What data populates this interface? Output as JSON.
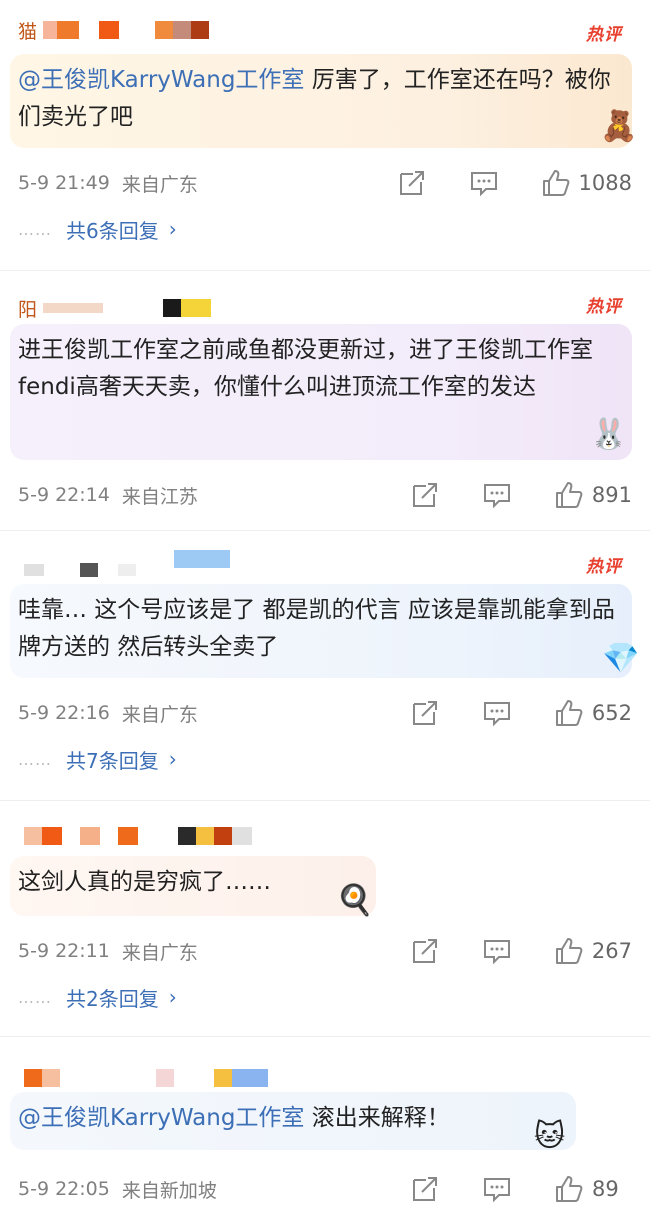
{
  "hot_badge": "热评",
  "comments": [
    {
      "name": "猫",
      "mention": "@王俊凯KarryWang工作室",
      "text": " 厉害了，工作室还在吗？被你们卖光了吧",
      "time": "5-9 21:49",
      "location": "来自广东",
      "likes": "1088",
      "replies": "共6条回复",
      "mosaic": [
        "#f6b49a",
        "#f07a2c",
        "#ffffff",
        "#f05a14",
        "#ffffff",
        "#f08a3c",
        "#c48a7a",
        "#ad3b14"
      ]
    },
    {
      "name": "阳",
      "mention": "",
      "text": "进王俊凯工作室之前咸鱼都没更新过，进了王俊凯工作室fendi高奢天天卖，你懂什么叫进顶流工作室的发达",
      "time": "5-9 22:14",
      "location": "来自江苏",
      "likes": "891",
      "replies": "",
      "mosaic": [
        "#e0e0e0",
        "#ffffff",
        "#1a1a1a",
        "#f5d43a",
        "#f5d43a"
      ]
    },
    {
      "name": "",
      "mention": "",
      "text": "哇靠… 这个号应该是了 都是凯的代言 应该是靠凯能拿到品牌方送的 然后转头全卖了",
      "time": "5-9 22:16",
      "location": "来自广东",
      "likes": "652",
      "replies": "共7条回复",
      "mosaic": [
        "#e0e0e0",
        "#ffffff",
        "#555555",
        "#ffffff",
        "#eeeeee",
        "#ffffff",
        "#9ccaf5",
        "#9ccaf5"
      ]
    },
    {
      "name": "",
      "mention": "",
      "text": "这剑人真的是穷疯了……",
      "time": "5-9 22:11",
      "location": "来自广东",
      "likes": "267",
      "replies": "共2条回复",
      "mosaic": [
        "#f6c0a0",
        "#f05a14",
        "#ffffff",
        "#f5b08a",
        "#ffffff",
        "#f06a1c",
        "#ffffff",
        "#2a2a2a",
        "#f5c040",
        "#c24010",
        "#e0e0e0"
      ]
    },
    {
      "name": "",
      "mention": "@王俊凯KarryWang工作室",
      "text": " 滚出来解释！",
      "time": "5-9 22:05",
      "location": "来自新加坡",
      "likes": "89",
      "replies": "",
      "mosaic": [
        "#f06a1c",
        "#f6c0a0",
        "#ffffff",
        "#ffffff",
        "#ffffff",
        "#f5d6d6",
        "#ffffff",
        "#f5c040",
        "#8ab4f0",
        "#8ab4f0"
      ]
    }
  ],
  "colors": {
    "mention": "#3d6fb6",
    "hot": "#e8402f",
    "meta": "#808080"
  },
  "icons": [
    "share-icon",
    "comment-icon",
    "like-icon",
    "chevron-right-icon"
  ]
}
